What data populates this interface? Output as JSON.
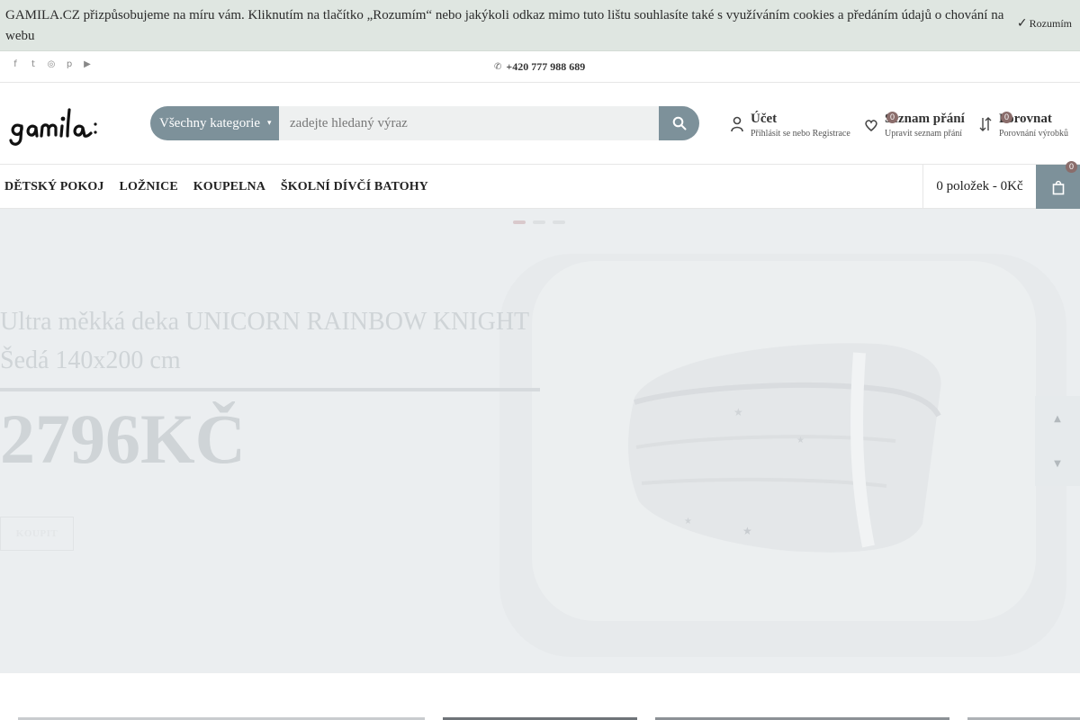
{
  "cookie": {
    "text": "GAMILA.CZ přizpůsobujeme na míru vám. Kliknutím na tlačítko „Rozumím“ nebo jakýkoli odkaz mimo tuto lištu souhlasíte také s využíváním cookies a předáním údajů o chování na webu",
    "accept_label": "Rozumím"
  },
  "topbar": {
    "socials": [
      "facebook-icon",
      "twitter-icon",
      "instagram-icon",
      "pinterest-icon",
      "youtube-icon"
    ],
    "phone": "+420 777 988 689"
  },
  "brand": {
    "logo_text": "gamila"
  },
  "search": {
    "category_label": "Všechny kategorie",
    "placeholder": "zadejte hledaný výraz"
  },
  "header": {
    "account": {
      "title": "Účet",
      "subtitle": "Přihlásit se nebo Registrace"
    },
    "wishlist": {
      "title": "Seznam přání",
      "subtitle": "Upravit seznam přání",
      "count": "0"
    },
    "compare": {
      "title": "Porovnat",
      "subtitle": "Porovnání výrobků",
      "count": "0"
    }
  },
  "nav": {
    "items": [
      "DĚTSKÝ POKOJ",
      "LOŽNICE",
      "KOUPELNA",
      "ŠKOLNÍ DÍVČÍ BATOHY"
    ],
    "cart_summary": "0 položek - 0Kč",
    "cart_count": "0"
  },
  "hero": {
    "title": "Ultra měkká deka UNICORN RAINBOW KNIGHT Šedá 140x200 cm",
    "price": "2796KČ",
    "button_label": "KOUPIT",
    "slides": 3,
    "active_slide": 1
  },
  "colors": {
    "accent": "#7d919a",
    "badge": "#8a6d6b",
    "cookie_bg": "#dfe6e1",
    "hero_bg": "#ebeef0"
  }
}
